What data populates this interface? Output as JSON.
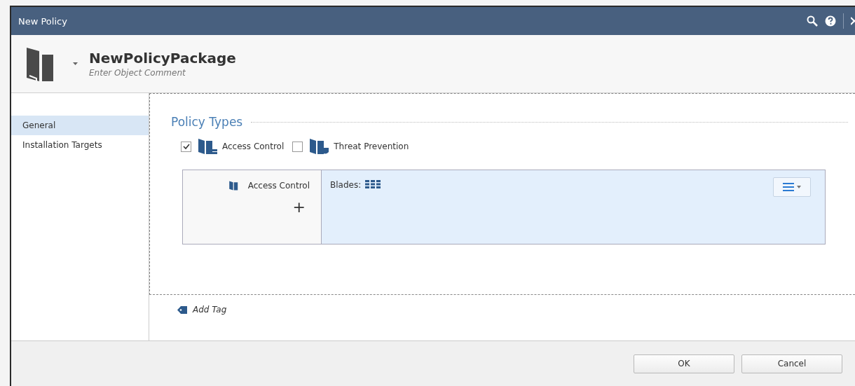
{
  "window": {
    "title": "New Policy"
  },
  "header": {
    "name": "NewPolicyPackage",
    "comment_placeholder": "Enter Object Comment"
  },
  "sidebar": {
    "items": [
      {
        "label": "General",
        "selected": true
      },
      {
        "label": "Installation Targets",
        "selected": false
      }
    ]
  },
  "section": {
    "title": "Policy Types"
  },
  "policy_types": [
    {
      "label": "Access Control",
      "checked": true,
      "kind": "access"
    },
    {
      "label": "Threat Prevention",
      "checked": false,
      "kind": "threat"
    }
  ],
  "layers": {
    "name": "Access Control",
    "add": "+",
    "blades_label": "Blades:"
  },
  "add_tag": "Add Tag",
  "buttons": [
    "OK",
    "Cancel"
  ]
}
